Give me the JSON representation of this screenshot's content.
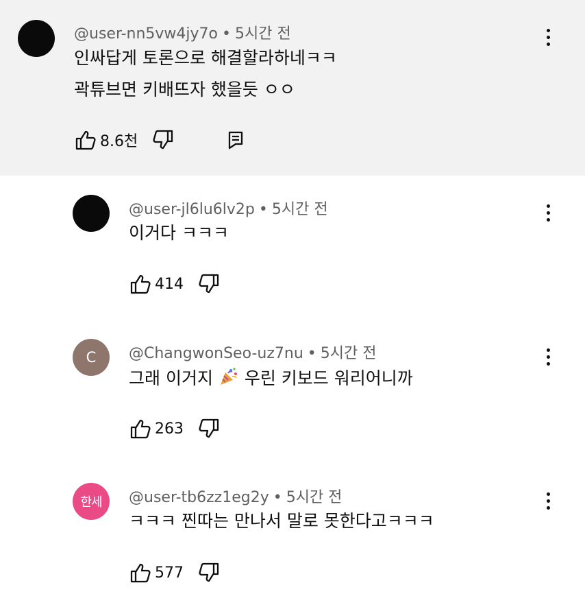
{
  "comments": [
    {
      "handle": "@user-nn5vw4jy7o",
      "time": "5시간 전",
      "lines": [
        "인싸답게 토론으로 해결할라하네ㅋㅋ",
        "곽튜브면 키배뜨자 했을듯 ㅇㅇ"
      ],
      "likes": "8.6천",
      "avatar_color": "#0a0a0a"
    },
    {
      "handle": "@user-jl6lu6lv2p",
      "time": "5시간 전",
      "lines": [
        "이거다 ㅋㅋㅋ"
      ],
      "likes": "414",
      "avatar_color": "#0a0a0a"
    },
    {
      "handle": "@ChangwonSeo-uz7nu",
      "time": "5시간 전",
      "text_before": "그래 이거지",
      "text_after": "우린 키보드 워리어니까",
      "emoji_icon": "party-popper-icon",
      "likes": "263",
      "avatar_letter": "C",
      "avatar_color": "#8f766c"
    },
    {
      "handle": "@user-tb6zz1eg2y",
      "time": "5시간 전",
      "lines": [
        "ㅋㅋㅋ 찐따는 만나서 말로 못한다고ㅋㅋㅋ"
      ],
      "likes": "577",
      "avatar_letter": "한세",
      "avatar_color": "#ea4b87"
    }
  ],
  "dot": "•"
}
